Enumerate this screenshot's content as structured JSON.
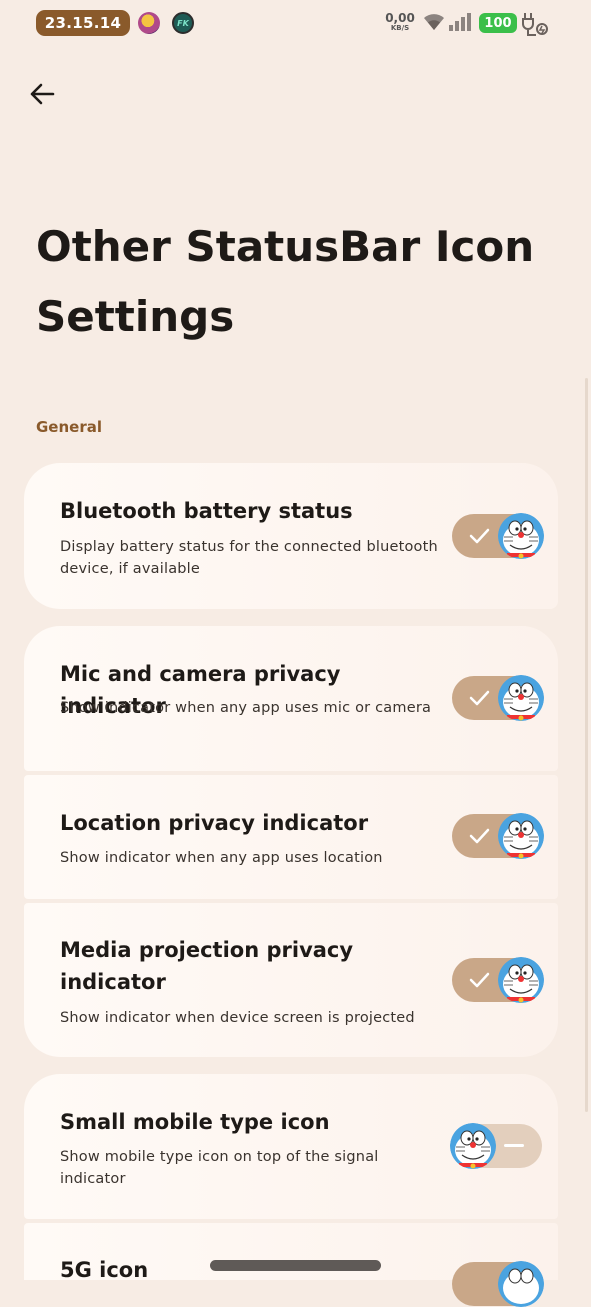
{
  "status_bar": {
    "time": "23.15.14",
    "app_icon_b_text": "FK",
    "net_speed_value": "0,00",
    "net_speed_unit": "KB/S",
    "battery_level": "100",
    "icons": [
      "app-avatar-icon",
      "app-fk-icon",
      "wifi-icon",
      "signal-icon",
      "battery-icon",
      "charging-icon"
    ]
  },
  "header": {
    "back_icon": "arrow-left-icon",
    "title": "Other StatusBar Icon Settings"
  },
  "section": {
    "label": "General"
  },
  "settings": [
    {
      "title": "Bluetooth battery status",
      "description": "Display battery status for the connected bluetooth device, if available",
      "enabled": true
    },
    {
      "title": "Mic and camera privacy indicator",
      "description": "Show indicator when any app uses mic or camera",
      "enabled": true
    },
    {
      "title": "Location privacy indicator",
      "description": "Show indicator when any app uses location",
      "enabled": true
    },
    {
      "title": "Media projection privacy indicator",
      "description": "Show indicator when device screen is projected",
      "enabled": true
    },
    {
      "title": "Small mobile type icon",
      "description": "Show mobile type icon on top of the signal indicator",
      "enabled": false
    },
    {
      "title": "5G icon",
      "description": "",
      "enabled": true
    }
  ],
  "colors": {
    "background": "#f7ece4",
    "accent_brown": "#8a5a2b",
    "toggle_on": "#c9a788",
    "toggle_off": "#e3cfbd",
    "battery_green": "#3bbf4a"
  }
}
